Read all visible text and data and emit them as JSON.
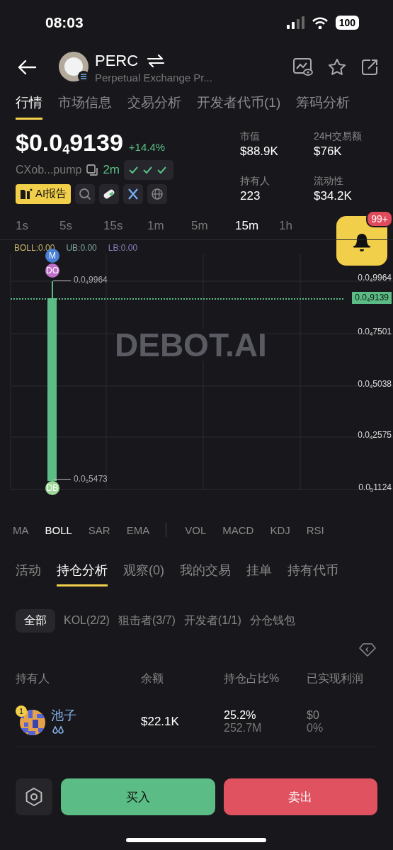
{
  "status_bar": {
    "time": "08:03",
    "battery": "100"
  },
  "header": {
    "symbol": "PERC",
    "name": "Perpetual Exchange Pr..."
  },
  "tabs": [
    {
      "label": "行情",
      "selected": true
    },
    {
      "label": "市场信息",
      "selected": false
    },
    {
      "label": "交易分析",
      "selected": false
    },
    {
      "label": "开发者代币(1)",
      "selected": false
    },
    {
      "label": "筹码分析",
      "selected": false
    }
  ],
  "price": {
    "value": "$0.0$_{4}$9139",
    "change": "+14.4%",
    "address": "CXob...pump",
    "age": "2m",
    "ai_report": "AI报告"
  },
  "stats": [
    {
      "label": "市值",
      "value": "$88.9K"
    },
    {
      "label": "24H交易额",
      "value": "$76K"
    },
    {
      "label": "持有人",
      "value": "223"
    },
    {
      "label": "流动性",
      "value": "$34.2K"
    }
  ],
  "timeframes": [
    {
      "label": "1s",
      "selected": false
    },
    {
      "label": "5s",
      "selected": false
    },
    {
      "label": "15s",
      "selected": false
    },
    {
      "label": "1m",
      "selected": false
    },
    {
      "label": "5m",
      "selected": false
    },
    {
      "label": "15m",
      "selected": true
    },
    {
      "label": "1h",
      "selected": false
    }
  ],
  "alert": {
    "badge": "99+"
  },
  "chart": {
    "legend": [
      {
        "label": "BOLL:0.00",
        "color": "#c9b56d"
      },
      {
        "label": "UB:0.00",
        "color": "#7fa89a"
      },
      {
        "label": "LB:0.00",
        "color": "#8f7fc0"
      }
    ],
    "watermark": "DEBOT.AI",
    "high_label": "0.0$_{4}$9964",
    "low_label": "0.0$_{5}$5473",
    "current_price": "0.0$_{4}$9139",
    "y_labels": [
      "0.0$_{4}$9964",
      "0.0$_{4}$7501",
      "0.0$_{4}$5038",
      "0.0$_{4}$2575",
      "0.0$_{5}$1124"
    ],
    "top_markers": [
      {
        "label": "M",
        "color": "#4a7fd6"
      },
      {
        "label": "DO",
        "color": "#c06fc9"
      }
    ],
    "bottom_markers": [
      {
        "label": "DB",
        "color": "#9ed99a"
      }
    ]
  },
  "indicators": [
    [
      {
        "label": "MA",
        "selected": false
      },
      {
        "label": "BOLL",
        "selected": true
      },
      {
        "label": "SAR",
        "selected": false
      },
      {
        "label": "EMA",
        "selected": false
      }
    ],
    [
      {
        "label": "VOL",
        "selected": false
      },
      {
        "label": "MACD",
        "selected": false
      },
      {
        "label": "KDJ",
        "selected": false
      },
      {
        "label": "RSI",
        "selected": false
      }
    ]
  ],
  "section_tabs": [
    {
      "label": "活动",
      "selected": false
    },
    {
      "label": "持仓分析",
      "selected": true
    },
    {
      "label": "观察(0)",
      "selected": false
    },
    {
      "label": "我的交易",
      "selected": false
    },
    {
      "label": "挂单",
      "selected": false
    },
    {
      "label": "持有代币",
      "selected": false
    }
  ],
  "filters": [
    {
      "label": "全部",
      "selected": true
    },
    {
      "label": "KOL(2/2)",
      "selected": false
    },
    {
      "label": "狙击者(3/7)",
      "selected": false
    },
    {
      "label": "开发者(1/1)",
      "selected": false
    },
    {
      "label": "分仓钱包",
      "selected": false
    }
  ],
  "table": {
    "columns": [
      "持有人",
      "余额",
      "持仓占比%",
      "已实现利润"
    ],
    "rows": [
      {
        "rank": "1",
        "name": "池子",
        "balance": "$22.1K",
        "share": "25.2%",
        "amount": "252.7M",
        "profit": "$0",
        "profit_pct": "0%"
      }
    ]
  },
  "buttons": {
    "buy": "买入",
    "sell": "卖出"
  }
}
